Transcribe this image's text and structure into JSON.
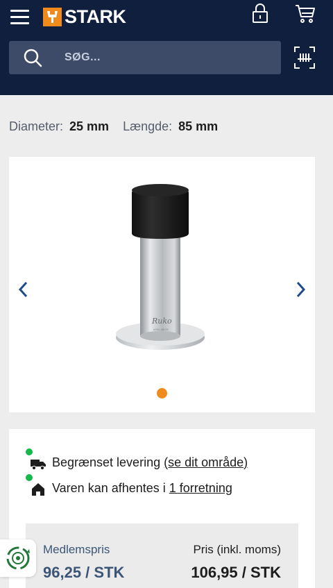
{
  "header": {
    "brand": "STARK",
    "icons": [
      "menu-icon",
      "stark-logo-icon",
      "lock-icon",
      "cart-icon",
      "search-icon",
      "barcode-scan-icon"
    ],
    "colors": {
      "background": "#0f1f3d",
      "search_bg": "#3d4a68",
      "accent": "#f08a1c"
    }
  },
  "search": {
    "placeholder": "SØG..."
  },
  "specs": [
    {
      "label": "Diameter:",
      "value": "25 mm"
    },
    {
      "label": "Længde:",
      "value": "85 mm"
    }
  ],
  "gallery": {
    "image_text": "Ruko",
    "image_subtext": "ASSA ABLOY",
    "total_images": 1,
    "active_index": 0
  },
  "availability": {
    "delivery_text": "Begrænset levering",
    "delivery_link": "(se dit område)",
    "pickup_text": "Varen kan afhentes i",
    "pickup_link": "1 forretning",
    "status_color": "#16b84a"
  },
  "pricing": {
    "member_label": "Medlemspris",
    "member_price": "96,25 / STK",
    "price_label": "Pris (inkl. moms)",
    "price": "106,95 / STK",
    "member_color": "#3b5577"
  },
  "badge": {
    "icon": "recycle-badge-icon",
    "color": "#1f7a3a"
  }
}
